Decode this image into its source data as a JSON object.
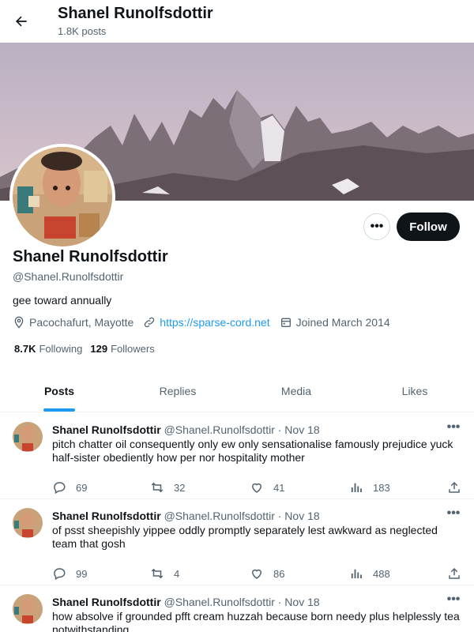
{
  "header": {
    "title": "Shanel Runolfsdottir",
    "subtitle": "1.8K posts"
  },
  "profile": {
    "name": "Shanel Runolfsdottir",
    "handle": "@Shanel.Runolfsdottir",
    "bio": "gee toward annually",
    "location": "Pacochafurt, Mayotte",
    "website": "https://sparse-cord.net",
    "joined": "Joined March 2014",
    "following_count": "8.7K",
    "following_label": "Following",
    "followers_count": "129",
    "followers_label": "Followers",
    "follow_label": "Follow",
    "more_label": "•••"
  },
  "tabs": [
    {
      "label": "Posts",
      "active": true
    },
    {
      "label": "Replies"
    },
    {
      "label": "Media"
    },
    {
      "label": "Likes"
    }
  ],
  "posts": [
    {
      "name": "Shanel Runolfsdottir",
      "meta": "@Shanel.Runolfsdottir · Nov 18",
      "text": "pitch chatter oil consequently only ew only sensationalise famously prejudice yuck half-sister obediently how per nor hospitality mother",
      "replies": "69",
      "reposts": "32",
      "likes": "41",
      "views": "183"
    },
    {
      "name": "Shanel Runolfsdottir",
      "meta": "@Shanel.Runolfsdottir · Nov 18",
      "text": "of psst sheepishly yippee oddly promptly separately lest awkward as neglected team that gosh",
      "replies": "99",
      "reposts": "4",
      "likes": "86",
      "views": "488"
    },
    {
      "name": "Shanel Runolfsdottir",
      "meta": "@Shanel.Runolfsdottir · Nov 18",
      "text": "how absolve if grounded pfft cream huzzah because born needy plus helplessly tea notwithstanding",
      "replies": "",
      "reposts": "",
      "likes": "",
      "views": ""
    }
  ],
  "post_more_label": "•••",
  "colors": {
    "accent": "#1d9bf0",
    "text": "#0f1419",
    "muted": "#536471",
    "border": "#eff3f4"
  }
}
